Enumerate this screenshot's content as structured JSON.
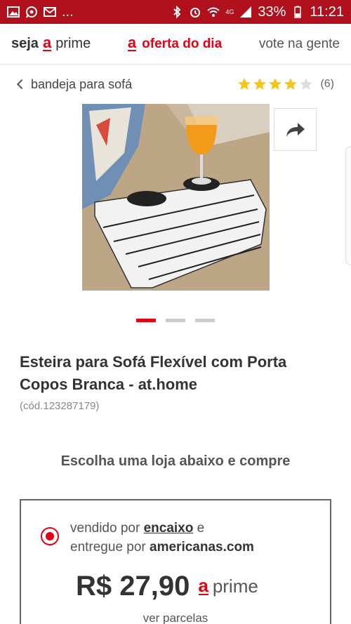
{
  "status_bar": {
    "ellipsis": "...",
    "network": "4G",
    "battery": "33%",
    "time": "11:21"
  },
  "nav": {
    "prime_prefix": "seja",
    "prime_logo": "a",
    "prime_suffix": "prime",
    "offer_logo": "a",
    "offer_label": "oferta do dia",
    "vote_label": "vote na gente"
  },
  "breadcrumb": {
    "label": "bandeja para sofá"
  },
  "rating": {
    "stars": 4,
    "max_stars": 5,
    "count": "(6)"
  },
  "product": {
    "title": "Esteira para Sofá Flexível com Porta Copos Branca - at.home",
    "code": "(cód.123287179)"
  },
  "carousel": {
    "total": 3,
    "active_index": 0
  },
  "choose_store": "Escolha uma loja abaixo e compre",
  "offer": {
    "sold_by_prefix": "vendido por",
    "seller": "encaixo",
    "sold_by_suffix": "e",
    "delivered_by_prefix": "entregue por",
    "deliverer": "americanas.com",
    "price": "R$ 27,90",
    "prime_logo": "a",
    "prime_label": "prime",
    "installments": "ver parcelas"
  },
  "colors": {
    "brand_red": "#e60014",
    "status_bar": "#b0101c",
    "star": "#f5c518"
  }
}
